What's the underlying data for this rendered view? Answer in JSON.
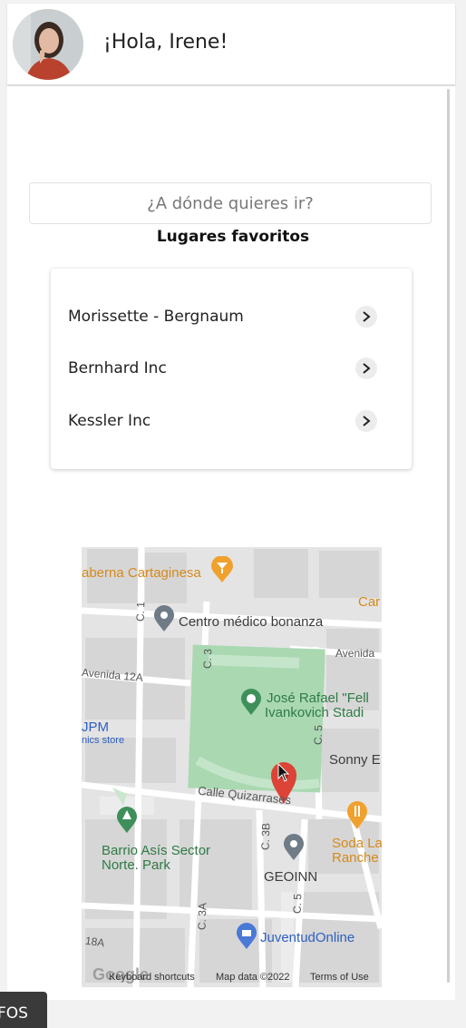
{
  "header": {
    "greeting": "¡Hola, Irene!",
    "avatar_alt": "avatar"
  },
  "search": {
    "placeholder": "¿A dónde quieres ir?"
  },
  "favorites": {
    "title": "Lugares favoritos",
    "items": [
      {
        "label": "Morissette - Bergnaum"
      },
      {
        "label": "Bernhard Inc"
      },
      {
        "label": "Kessler Inc"
      }
    ]
  },
  "map": {
    "labels": {
      "taberna": "aberna Cartaginesa",
      "car": "Car",
      "c1": "C. 1",
      "centro_medico": "Centro médico bonanza",
      "c3_top": "C. 3",
      "avenida_right": "Avenida",
      "avenida_12a": "Avenida 12A",
      "stadium_line1": "José Rafael \"Fell",
      "stadium_line2": "Ivankovich Stadi",
      "jpm": "JPM",
      "jpm_sub": "nics store",
      "c5_top": "C. 5",
      "sonny": "Sonny E",
      "calle_quizarrases": "Calle Quizarrases",
      "c3b": "C. 3B",
      "soda_line1": "Soda La",
      "soda_line2": "Ranche",
      "barrio_line1": "Barrio Asís Sector",
      "barrio_line2": "Norte. Park",
      "geoinn": "GEOINN",
      "c5_bottom": "C. 5",
      "c3a": "C. 3A",
      "juventud": "JuventudOnline",
      "street_18a": "18A",
      "google": "Google"
    },
    "footer": {
      "shortcuts": "Keyboard shortcuts",
      "map_data": "Map data ©2022",
      "terms": "Terms of Use"
    }
  },
  "bottom_tab": {
    "label": "FOS"
  },
  "colors": {
    "map_base": "#e6e6e6",
    "park_green": "#a9d8b1",
    "marker_red": "#db4437",
    "marker_gray": "#6f7b86",
    "marker_orange": "#f0a12d",
    "marker_green": "#3e8f5a",
    "marker_blue": "#4a79d6"
  }
}
